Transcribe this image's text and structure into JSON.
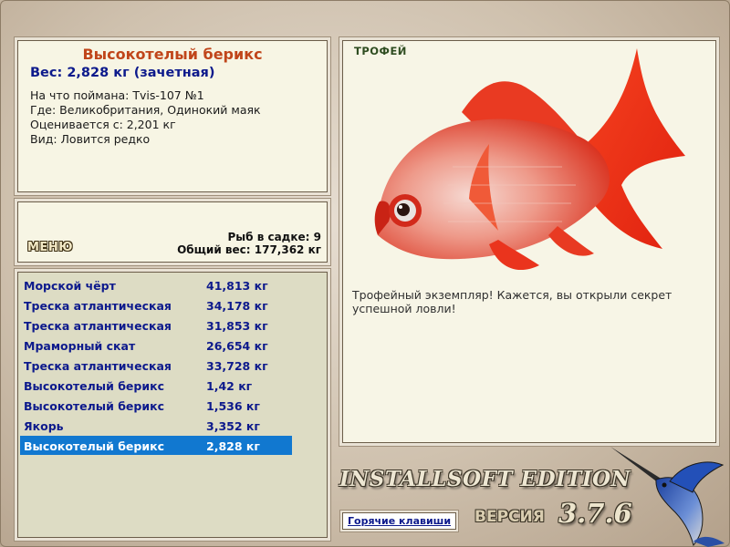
{
  "info": {
    "title": "Высокотелый берикс",
    "weight": "Вес: 2,828 кг (зачетная)",
    "caught_on": "На что поймана: Tvis-107 №1",
    "location": "Где: Великобритания, Одинокий маяк",
    "valued_from": "Оценивается с: 2,201 кг",
    "kind": "Вид: Ловится редко"
  },
  "menu": {
    "button": "МЕНЮ",
    "fish_in_keepnet": "Рыб в садке: 9",
    "total_weight": "Общий вес: 177,362 кг"
  },
  "catch_list": [
    {
      "name": "Морской чёрт",
      "weight": "41,813 кг"
    },
    {
      "name": "Треска атлантическая",
      "weight": "34,178 кг"
    },
    {
      "name": "Треска атлантическая",
      "weight": "31,853 кг"
    },
    {
      "name": "Мраморный скат",
      "weight": "26,654 кг"
    },
    {
      "name": "Треска атлантическая",
      "weight": "33,728 кг"
    },
    {
      "name": "Высокотелый берикс",
      "weight": "1,42 кг"
    },
    {
      "name": "Высокотелый берикс",
      "weight": "1,536 кг"
    },
    {
      "name": "Якорь",
      "weight": "3,352 кг"
    },
    {
      "name": "Высокотелый берикс",
      "weight": "2,828 кг"
    }
  ],
  "selected_index": 8,
  "trophy": {
    "label": "ТРОФЕЙ",
    "message": "Трофейный экземпляр! Кажется, вы открыли секрет успешной ловли!"
  },
  "brand": {
    "edition": "INSTALLSOFT EDITION",
    "hotkeys": "Горячие клавиши",
    "version_label": "ВЕРСИЯ",
    "version": "3.7.6"
  },
  "colors": {
    "accent_title": "#c0451a",
    "list_text": "#0d1a8c",
    "selection": "#1178d0",
    "fish_red": "#e8301f"
  },
  "icons": [
    "fish-image",
    "marlin-logo"
  ]
}
